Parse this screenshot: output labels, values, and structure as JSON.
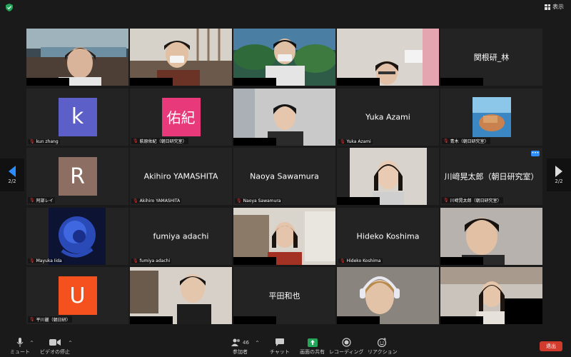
{
  "topbar": {
    "view_label": "表示"
  },
  "navigation": {
    "page_left": "2/2",
    "page_right": "2/2"
  },
  "tiles": [
    {
      "type": "video",
      "name": ""
    },
    {
      "type": "video",
      "name": ""
    },
    {
      "type": "video",
      "name": ""
    },
    {
      "type": "video",
      "name": ""
    },
    {
      "type": "text",
      "name": "",
      "center": "関根研_林"
    },
    {
      "type": "avatar",
      "name": "kun zhang",
      "avatar_text": "k",
      "avatar_color": "#5b5fc7",
      "muted": true
    },
    {
      "type": "avatar",
      "name": "萩原佑紀（朝日研究室）",
      "avatar_text": "佑紀",
      "avatar_color": "#e8397a",
      "muted": true
    },
    {
      "type": "video",
      "name": ""
    },
    {
      "type": "text",
      "name": "Yuka Azami",
      "center": "Yuka Azami",
      "muted": true
    },
    {
      "type": "image",
      "name": "青木（朝日研究室）",
      "muted": true
    },
    {
      "type": "avatar",
      "name": "阿部レイ",
      "avatar_text": "R",
      "avatar_color": "#8d6e63",
      "muted": true
    },
    {
      "type": "text",
      "name": "Akihiro YAMASHITA",
      "center": "Akihiro YAMASHITA",
      "muted": true
    },
    {
      "type": "text",
      "name": "Naoya Sawamura",
      "center": "Naoya Sawamura",
      "muted": true
    },
    {
      "type": "video",
      "name": ""
    },
    {
      "type": "text",
      "name": "川﨑晃太郎（朝日研究室）",
      "center": "川﨑晃太郎（朝日研究室）",
      "muted": true
    },
    {
      "type": "image",
      "name": "Mayuka Iida",
      "muted": true
    },
    {
      "type": "text",
      "name": "fumiya adachi",
      "center": "fumiya adachi",
      "muted": true
    },
    {
      "type": "video",
      "name": ""
    },
    {
      "type": "text",
      "name": "Hideko Koshima",
      "center": "Hideko Koshima",
      "muted": true
    },
    {
      "type": "video",
      "name": ""
    },
    {
      "type": "avatar",
      "name": "平川麗（朝日研）",
      "avatar_text": "U",
      "avatar_color": "#f4511e",
      "muted": true
    },
    {
      "type": "video",
      "name": ""
    },
    {
      "type": "text",
      "name": "",
      "center": "平田和也"
    },
    {
      "type": "video",
      "name": ""
    },
    {
      "type": "video",
      "name": ""
    }
  ],
  "toolbar": {
    "mute_label": "ミュート",
    "video_label": "ビデオの停止",
    "participants_label": "参加者",
    "participants_count": "46",
    "chat_label": "チャット",
    "share_label": "画面の共有",
    "record_label": "レコーディング",
    "reaction_label": "リアクション",
    "leave_label": "退出"
  },
  "colors": {
    "accent": "#2d8cff",
    "share_green": "#23a55a",
    "leave_red": "#d13b2e",
    "muted_red": "#e33333"
  }
}
